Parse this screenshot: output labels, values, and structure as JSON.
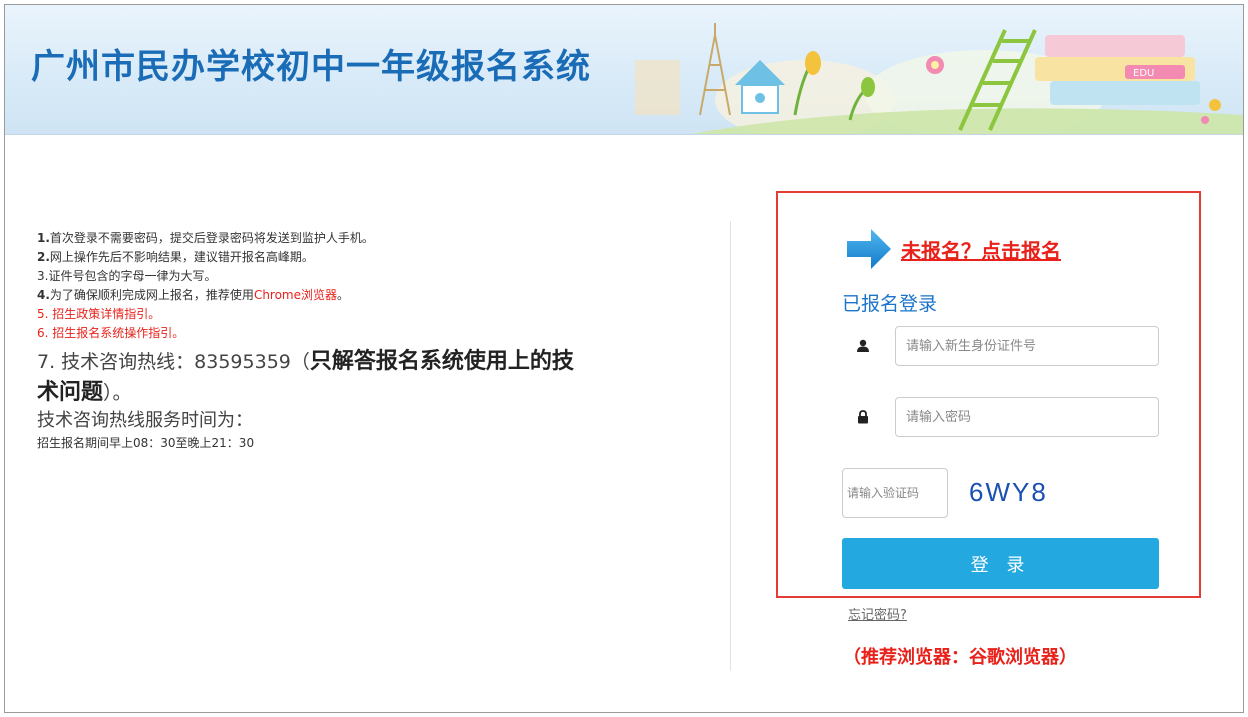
{
  "header": {
    "title": "广州市民办学校初中一年级报名系统",
    "book_label": "EDU"
  },
  "info": {
    "line1_num": "1.",
    "line1_text": "首次登录不需要密码，提交后登录密码将发送到监护人手机。",
    "line2_num": "2.",
    "line2_text": "网上操作先后不影响结果，建议错开报名高峰期。",
    "line3_text": "3.证件号包含的字母一律为大写。",
    "line4_num": "4.",
    "line4_text": "为了确保顺利完成网上报名，推荐使用",
    "line4_browser": "Chrome浏览器",
    "line4_end": "。",
    "line5_text": "5. 招生政策详情指引。",
    "line6_text": "6. 招生报名系统操作指引。",
    "hotline_prefix": "7. 技术咨询热线：83595359（",
    "hotline_strong": "只解答报名系统使用上的技",
    "hotline_strong2": "术问题",
    "hotline_suffix": "）。",
    "service_title": "技术咨询热线服务时间为：",
    "service_time": "招生报名期间早上08：30至晚上21：30"
  },
  "login": {
    "register_link": "未报名？点击报名",
    "heading": "已报名登录",
    "id_placeholder": "请输入新生身份证件号",
    "password_placeholder": "请输入密码",
    "captcha_placeholder": "请输入验证码",
    "captcha_code": "6WY8",
    "submit_label": "登 录",
    "forgot_label": "忘记密码?",
    "browser_note": "（推荐浏览器：谷歌浏览器）"
  },
  "colors": {
    "brand_blue": "#1b6cb7",
    "button_blue": "#23a8e0",
    "alert_red": "#e8221b",
    "highlight_border": "#e33b36"
  }
}
